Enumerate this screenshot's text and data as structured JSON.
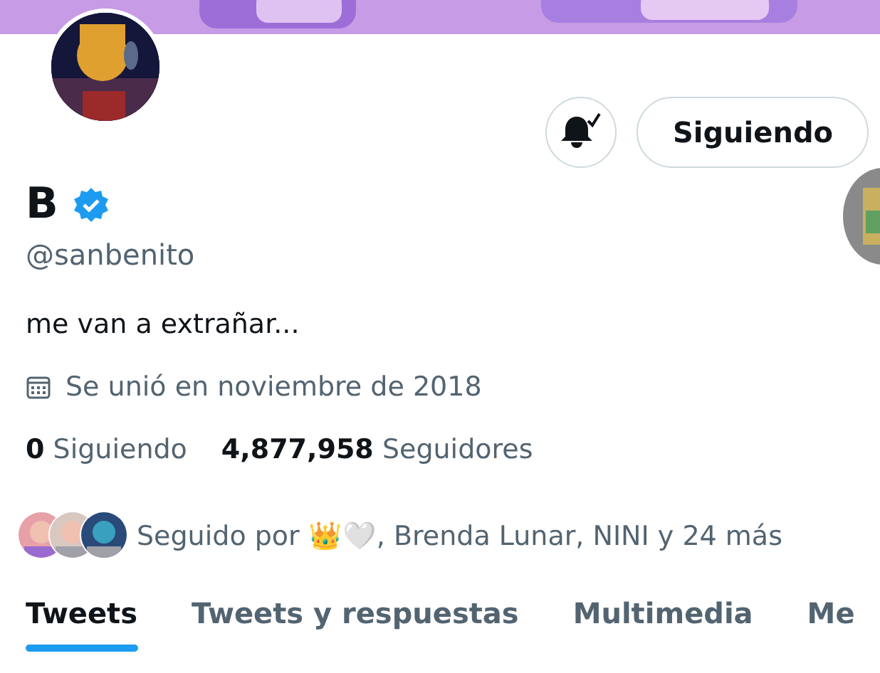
{
  "profile": {
    "name": "B",
    "verified": true,
    "handle": "@sanbenito",
    "bio": "me van a extrañar...",
    "joined": "Se unió en noviembre de 2018"
  },
  "actions": {
    "notifications_on": true,
    "follow_button": "Siguiendo"
  },
  "stats": [
    {
      "count": "0",
      "label": "Siguiendo"
    },
    {
      "count": "4,877,958",
      "label": "Seguidores"
    }
  ],
  "followed_by": "Seguido por 👑🤍, Brenda Lunar, NINI y 24 más",
  "tabs": [
    {
      "label": "Tweets",
      "selected": true
    },
    {
      "label": "Tweets y respuestas",
      "selected": false
    },
    {
      "label": "Multimedia",
      "selected": false
    },
    {
      "label": "Me",
      "selected": false
    }
  ]
}
